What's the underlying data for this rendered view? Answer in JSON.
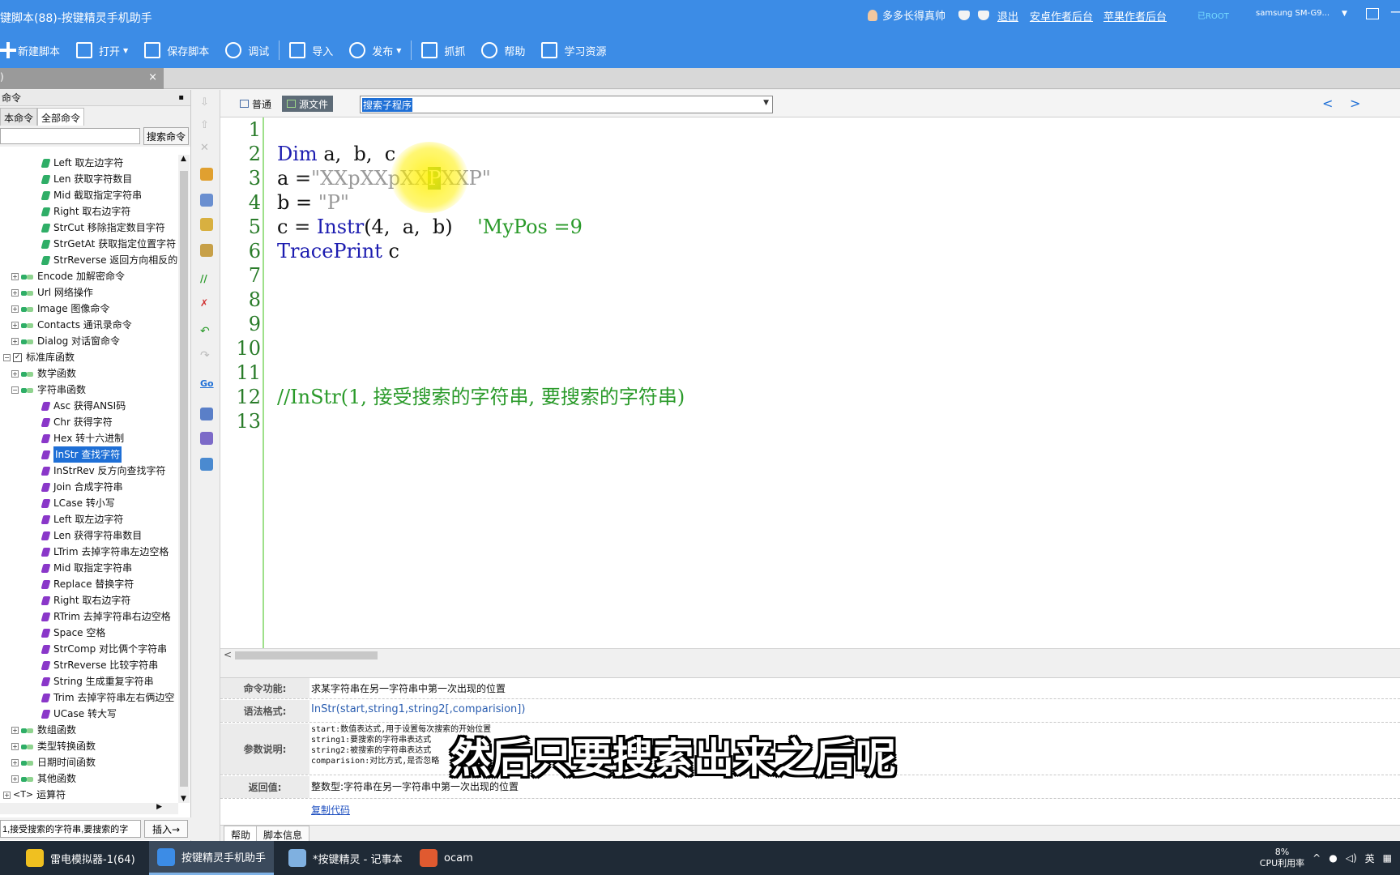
{
  "window": {
    "title": "键脚本(88)-按键精灵手机助手",
    "user_name": "多多长得真帅",
    "links": [
      "退出",
      "安卓作者后台",
      "苹果作者后台"
    ],
    "root_badge": "已ROOT",
    "device": "samsung  SM-G9..."
  },
  "toolbar": {
    "new_script": "新建脚本",
    "open": "打开",
    "save_script": "保存脚本",
    "debug": "调试",
    "import": "导入",
    "publish": "发布",
    "capture": "抓抓",
    "help": "帮助",
    "learn": "学习资源"
  },
  "tabstrip": {
    "tab_label": ")",
    "close": "×"
  },
  "left_panel": {
    "header": "命令",
    "tabs": [
      "本命令",
      "全部命令"
    ],
    "search_button": "搜索命令",
    "search_value": "",
    "tree": [
      {
        "label": "Left 取左边字符",
        "level": 2,
        "kind": "g"
      },
      {
        "label": "Len 获取字符数目",
        "level": 2,
        "kind": "g"
      },
      {
        "label": "Mid 截取指定字符串",
        "level": 2,
        "kind": "g"
      },
      {
        "label": "Right 取右边字符",
        "level": 2,
        "kind": "g"
      },
      {
        "label": "StrCut 移除指定数目字符",
        "level": 2,
        "kind": "g"
      },
      {
        "label": "StrGetAt 获取指定位置字符",
        "level": 2,
        "kind": "g"
      },
      {
        "label": "StrReverse 返回方向相反的",
        "level": 2,
        "kind": "g"
      },
      {
        "label": "Encode 加解密命令",
        "level": 1,
        "kind": "folder"
      },
      {
        "label": "Url 网络操作",
        "level": 1,
        "kind": "folder"
      },
      {
        "label": "Image 图像命令",
        "level": 1,
        "kind": "folder"
      },
      {
        "label": "Contacts 通讯录命令",
        "level": 1,
        "kind": "folder"
      },
      {
        "label": "Dialog 对话窗命令",
        "level": 1,
        "kind": "folder"
      },
      {
        "label": "标准库函数",
        "level": 0,
        "kind": "root"
      },
      {
        "label": "数学函数",
        "level": 1,
        "kind": "folder"
      },
      {
        "label": "字符串函数",
        "level": 1,
        "kind": "folder-open"
      },
      {
        "label": "Asc 获得ANSI码",
        "level": 2,
        "kind": "p"
      },
      {
        "label": "Chr 获得字符",
        "level": 2,
        "kind": "p"
      },
      {
        "label": "Hex 转十六进制",
        "level": 2,
        "kind": "p"
      },
      {
        "label": "InStr 查找字符",
        "level": 2,
        "kind": "p",
        "selected": true
      },
      {
        "label": "InStrRev 反方向查找字符",
        "level": 2,
        "kind": "p"
      },
      {
        "label": "Join 合成字符串",
        "level": 2,
        "kind": "p"
      },
      {
        "label": "LCase 转小写",
        "level": 2,
        "kind": "p"
      },
      {
        "label": "Left 取左边字符",
        "level": 2,
        "kind": "p"
      },
      {
        "label": "Len 获得字符串数目",
        "level": 2,
        "kind": "p"
      },
      {
        "label": "LTrim 去掉字符串左边空格",
        "level": 2,
        "kind": "p"
      },
      {
        "label": "Mid 取指定字符串",
        "level": 2,
        "kind": "p"
      },
      {
        "label": "Replace 替换字符",
        "level": 2,
        "kind": "p"
      },
      {
        "label": "Right 取右边字符",
        "level": 2,
        "kind": "p"
      },
      {
        "label": "RTrim 去掉字符串右边空格",
        "level": 2,
        "kind": "p"
      },
      {
        "label": "Space 空格",
        "level": 2,
        "kind": "p"
      },
      {
        "label": "StrComp 对比俩个字符串",
        "level": 2,
        "kind": "p"
      },
      {
        "label": "StrReverse 比较字符串",
        "level": 2,
        "kind": "p"
      },
      {
        "label": "String 生成重复字符串",
        "level": 2,
        "kind": "p"
      },
      {
        "label": "Trim 去掉字符串左右俩边空",
        "level": 2,
        "kind": "p"
      },
      {
        "label": "UCase 转大写",
        "level": 2,
        "kind": "p"
      },
      {
        "label": "数组函数",
        "level": 1,
        "kind": "folder"
      },
      {
        "label": "类型转换函数",
        "level": 1,
        "kind": "folder"
      },
      {
        "label": "日期时间函数",
        "level": 1,
        "kind": "folder"
      },
      {
        "label": "其他函数",
        "level": 1,
        "kind": "folder"
      },
      {
        "label": "运算符",
        "level": 0,
        "kind": "op"
      }
    ],
    "bottom_input": "1,接受搜索的字符串,要搜索的字",
    "insert_button": "插入→"
  },
  "editor_top": {
    "view_normal": "普通",
    "view_source": "源文件",
    "subroutine": "搜索子程序"
  },
  "code": {
    "line_numbers": [
      "1",
      "2",
      "3",
      "4",
      "5",
      "6",
      "7",
      "8",
      "9",
      "10",
      "11",
      "12",
      "13"
    ],
    "l2_kw": "Dim",
    "l2_rest": " a,  b,  c",
    "l3_a": "a =",
    "l3_str1": "\"XXpXXpXX",
    "l3_cursor": "P",
    "l3_str2": "XXP\"",
    "l4_a": "b = ",
    "l4_str": "\"P\"",
    "l5_a": "c = ",
    "l5_fn": "Instr",
    "l5_rest": "(4,  a,  b)    ",
    "l5_cm": "'MyPos =9",
    "l6_fn": "TracePrint",
    "l6_rest": " c",
    "l12_cm": "//InStr(1, 接受搜索的字符串, 要搜索的字符串)"
  },
  "help": {
    "func_label": "命令功能:",
    "func_value": "求某字符串在另一字符串中第一次出现的位置",
    "syntax_label": "语法格式:",
    "syntax_value": "InStr(start,string1,string2[,comparision])",
    "params_label": "参数说明:",
    "params": [
      "start:数值表达式,用于设置每次搜索的开始位置",
      "string1:要搜索的字符串表达式",
      "string2:被搜索的字符串表达式",
      "comparision:对比方式,是否忽略"
    ],
    "return_label": "返回值:",
    "return_value": "整数型:字符串在另一字符串中第一次出现的位置",
    "copy_code": "复制代码",
    "tabs": [
      "帮助",
      "脚本信息"
    ]
  },
  "caption": "然后只要搜索出来之后呢",
  "taskbar": {
    "items": [
      "雷电模拟器-1(64)",
      "按键精灵手机助手",
      "*按键精灵 - 记事本",
      "ocam"
    ],
    "cpu_percent": "8%",
    "cpu_label": "CPU利用率",
    "lang": "英"
  },
  "colors": {
    "titlebar": "#3c8ce6",
    "keyword": "#1c1cb0",
    "comment": "#2a9a2a",
    "selected": "#1e6fd6"
  }
}
